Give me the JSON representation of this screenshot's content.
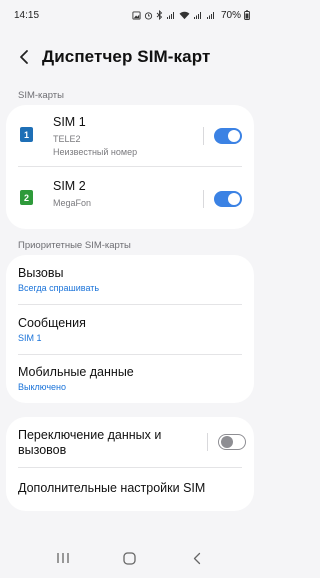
{
  "status_bar": {
    "time": "14:15",
    "battery": "70%",
    "icons": [
      "image-icon",
      "alarm-icon",
      "bluetooth-icon",
      "signal-icon",
      "wifi-icon",
      "signal-icon",
      "signal-icon",
      "battery-icon"
    ]
  },
  "header": {
    "title": "Диспетчер SIM-карт",
    "back_icon": "back-arrow-icon"
  },
  "sim_section": {
    "label": "SIM-карты",
    "sims": [
      {
        "badge": "1",
        "badge_color": "#1e6fb6",
        "name": "SIM 1",
        "carrier": "TELE2",
        "number": "Неизвестный номер",
        "enabled": true
      },
      {
        "badge": "2",
        "badge_color": "#2e9a3a",
        "name": "SIM 2",
        "carrier": "MegaFon",
        "enabled": true
      }
    ]
  },
  "priority_section": {
    "label": "Приоритетные SIM-карты",
    "items": [
      {
        "title": "Вызовы",
        "value": "Всегда спрашивать"
      },
      {
        "title": "Сообщения",
        "value": "SIM 1"
      },
      {
        "title": "Мобильные данные",
        "value": "Выключено"
      }
    ]
  },
  "other_section": {
    "switch_title_line1": "Переключение данных и",
    "switch_title_line2": "вызовов",
    "switch_enabled": false,
    "more_settings": "Дополнительные настройки SIM"
  },
  "navbar": {
    "icons": [
      "recent-apps-icon",
      "home-icon",
      "back-icon"
    ]
  },
  "colors": {
    "accent": "#3b82e4",
    "link_blue": "#1a73d9",
    "background": "#f5f5f7"
  }
}
